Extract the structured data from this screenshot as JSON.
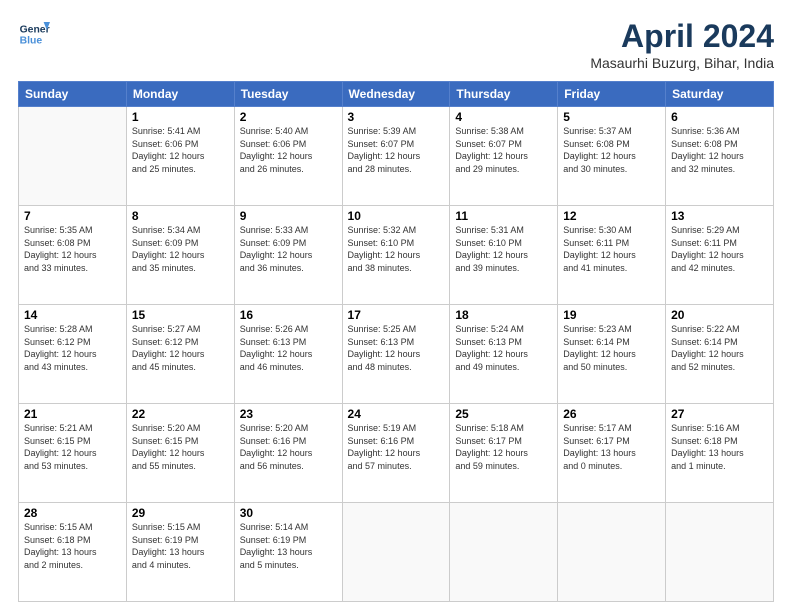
{
  "header": {
    "logo": {
      "line1": "General",
      "line2": "Blue"
    },
    "title": "April 2024",
    "subtitle": "Masaurhi Buzurg, Bihar, India"
  },
  "days_of_week": [
    "Sunday",
    "Monday",
    "Tuesday",
    "Wednesday",
    "Thursday",
    "Friday",
    "Saturday"
  ],
  "weeks": [
    [
      {
        "day": "",
        "info": ""
      },
      {
        "day": "1",
        "info": "Sunrise: 5:41 AM\nSunset: 6:06 PM\nDaylight: 12 hours\nand 25 minutes."
      },
      {
        "day": "2",
        "info": "Sunrise: 5:40 AM\nSunset: 6:06 PM\nDaylight: 12 hours\nand 26 minutes."
      },
      {
        "day": "3",
        "info": "Sunrise: 5:39 AM\nSunset: 6:07 PM\nDaylight: 12 hours\nand 28 minutes."
      },
      {
        "day": "4",
        "info": "Sunrise: 5:38 AM\nSunset: 6:07 PM\nDaylight: 12 hours\nand 29 minutes."
      },
      {
        "day": "5",
        "info": "Sunrise: 5:37 AM\nSunset: 6:08 PM\nDaylight: 12 hours\nand 30 minutes."
      },
      {
        "day": "6",
        "info": "Sunrise: 5:36 AM\nSunset: 6:08 PM\nDaylight: 12 hours\nand 32 minutes."
      }
    ],
    [
      {
        "day": "7",
        "info": "Sunrise: 5:35 AM\nSunset: 6:08 PM\nDaylight: 12 hours\nand 33 minutes."
      },
      {
        "day": "8",
        "info": "Sunrise: 5:34 AM\nSunset: 6:09 PM\nDaylight: 12 hours\nand 35 minutes."
      },
      {
        "day": "9",
        "info": "Sunrise: 5:33 AM\nSunset: 6:09 PM\nDaylight: 12 hours\nand 36 minutes."
      },
      {
        "day": "10",
        "info": "Sunrise: 5:32 AM\nSunset: 6:10 PM\nDaylight: 12 hours\nand 38 minutes."
      },
      {
        "day": "11",
        "info": "Sunrise: 5:31 AM\nSunset: 6:10 PM\nDaylight: 12 hours\nand 39 minutes."
      },
      {
        "day": "12",
        "info": "Sunrise: 5:30 AM\nSunset: 6:11 PM\nDaylight: 12 hours\nand 41 minutes."
      },
      {
        "day": "13",
        "info": "Sunrise: 5:29 AM\nSunset: 6:11 PM\nDaylight: 12 hours\nand 42 minutes."
      }
    ],
    [
      {
        "day": "14",
        "info": "Sunrise: 5:28 AM\nSunset: 6:12 PM\nDaylight: 12 hours\nand 43 minutes."
      },
      {
        "day": "15",
        "info": "Sunrise: 5:27 AM\nSunset: 6:12 PM\nDaylight: 12 hours\nand 45 minutes."
      },
      {
        "day": "16",
        "info": "Sunrise: 5:26 AM\nSunset: 6:13 PM\nDaylight: 12 hours\nand 46 minutes."
      },
      {
        "day": "17",
        "info": "Sunrise: 5:25 AM\nSunset: 6:13 PM\nDaylight: 12 hours\nand 48 minutes."
      },
      {
        "day": "18",
        "info": "Sunrise: 5:24 AM\nSunset: 6:13 PM\nDaylight: 12 hours\nand 49 minutes."
      },
      {
        "day": "19",
        "info": "Sunrise: 5:23 AM\nSunset: 6:14 PM\nDaylight: 12 hours\nand 50 minutes."
      },
      {
        "day": "20",
        "info": "Sunrise: 5:22 AM\nSunset: 6:14 PM\nDaylight: 12 hours\nand 52 minutes."
      }
    ],
    [
      {
        "day": "21",
        "info": "Sunrise: 5:21 AM\nSunset: 6:15 PM\nDaylight: 12 hours\nand 53 minutes."
      },
      {
        "day": "22",
        "info": "Sunrise: 5:20 AM\nSunset: 6:15 PM\nDaylight: 12 hours\nand 55 minutes."
      },
      {
        "day": "23",
        "info": "Sunrise: 5:20 AM\nSunset: 6:16 PM\nDaylight: 12 hours\nand 56 minutes."
      },
      {
        "day": "24",
        "info": "Sunrise: 5:19 AM\nSunset: 6:16 PM\nDaylight: 12 hours\nand 57 minutes."
      },
      {
        "day": "25",
        "info": "Sunrise: 5:18 AM\nSunset: 6:17 PM\nDaylight: 12 hours\nand 59 minutes."
      },
      {
        "day": "26",
        "info": "Sunrise: 5:17 AM\nSunset: 6:17 PM\nDaylight: 13 hours\nand 0 minutes."
      },
      {
        "day": "27",
        "info": "Sunrise: 5:16 AM\nSunset: 6:18 PM\nDaylight: 13 hours\nand 1 minute."
      }
    ],
    [
      {
        "day": "28",
        "info": "Sunrise: 5:15 AM\nSunset: 6:18 PM\nDaylight: 13 hours\nand 2 minutes."
      },
      {
        "day": "29",
        "info": "Sunrise: 5:15 AM\nSunset: 6:19 PM\nDaylight: 13 hours\nand 4 minutes."
      },
      {
        "day": "30",
        "info": "Sunrise: 5:14 AM\nSunset: 6:19 PM\nDaylight: 13 hours\nand 5 minutes."
      },
      {
        "day": "",
        "info": ""
      },
      {
        "day": "",
        "info": ""
      },
      {
        "day": "",
        "info": ""
      },
      {
        "day": "",
        "info": ""
      }
    ]
  ]
}
